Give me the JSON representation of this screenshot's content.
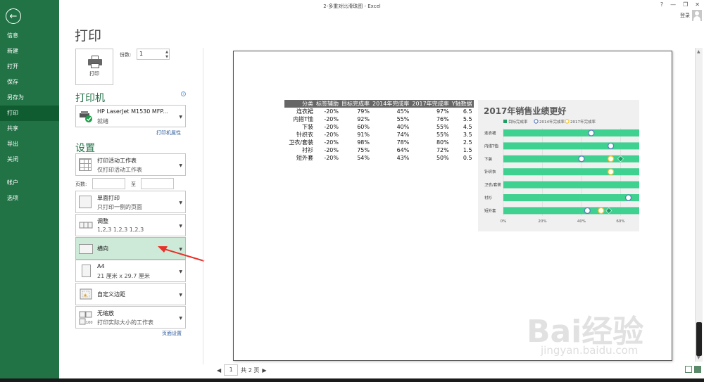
{
  "window": {
    "title": "2-多重对比滑珠图 - Excel",
    "help": "?",
    "minimize": "—",
    "restore": "❐",
    "close": "✕",
    "login": "登录"
  },
  "nav": {
    "back_icon": "←",
    "items": [
      "信息",
      "新建",
      "打开",
      "保存",
      "另存为",
      "打印",
      "共享",
      "导出",
      "关闭",
      "帐户",
      "选项"
    ],
    "active": "打印"
  },
  "print": {
    "title": "打印",
    "button_label": "打印",
    "copies_label": "份数:",
    "copies_value": "1",
    "printer_heading": "打印机",
    "printer_name": "HP LaserJet M1530 MFP...",
    "printer_status": "就绪",
    "printer_props_link": "打印机属性",
    "settings_heading": "设置",
    "scope_l1": "打印活动工作表",
    "scope_l2": "仅打印活动工作表",
    "pages_label": "页数:",
    "pages_to": "至",
    "sides_l1": "单面打印",
    "sides_l2": "只打印一侧的页面",
    "collate_l1": "调整",
    "collate_l2": "1,2,3    1,2,3    1,2,3",
    "orientation": "横向",
    "paper_l1": "A4",
    "paper_l2": "21 厘米 x 29.7 厘米",
    "margins": "自定义边距",
    "scaling_l1": "无缩放",
    "scaling_l2": "打印实际大小的工作表",
    "page_setup_link": "页面设置"
  },
  "table": {
    "headers": [
      "分类",
      "标签辅助",
      "目标完成率",
      "2014年完成率",
      "2017年完成率",
      "Y轴数据"
    ],
    "rows": [
      [
        "连衣裙",
        "-20%",
        "79%",
        "45%",
        "97%",
        "6.5"
      ],
      [
        "内搭T恤",
        "-20%",
        "92%",
        "55%",
        "76%",
        "5.5"
      ],
      [
        "下装",
        "-20%",
        "60%",
        "40%",
        "55%",
        "4.5"
      ],
      [
        "针织衣",
        "-20%",
        "91%",
        "74%",
        "55%",
        "3.5"
      ],
      [
        "卫衣/套装",
        "-20%",
        "98%",
        "78%",
        "80%",
        "2.5"
      ],
      [
        "衬衫",
        "-20%",
        "75%",
        "64%",
        "72%",
        "1.5"
      ],
      [
        "短外套",
        "-20%",
        "54%",
        "43%",
        "50%",
        "0.5"
      ]
    ]
  },
  "chart_data": {
    "type": "scatter",
    "title": "2017年销售业绩更好",
    "legend": [
      "目标完成率",
      "2014年完成率",
      "2017年完成率"
    ],
    "categories": [
      "连衣裙",
      "内搭T恤",
      "下装",
      "针织衣",
      "卫衣/套装",
      "衬衫",
      "短外套"
    ],
    "series": [
      {
        "name": "目标完成率",
        "values": [
          0.79,
          0.92,
          0.6,
          0.91,
          0.98,
          0.75,
          0.54
        ]
      },
      {
        "name": "2014年完成率",
        "values": [
          0.45,
          0.55,
          0.4,
          0.74,
          0.78,
          0.64,
          0.43
        ]
      },
      {
        "name": "2017年完成率",
        "values": [
          0.97,
          0.76,
          0.55,
          0.55,
          0.8,
          0.72,
          0.5
        ]
      }
    ],
    "x_ticks": [
      "0%",
      "20%",
      "40%",
      "60%"
    ],
    "xlim": [
      0,
      0.7
    ],
    "legend_position": "top",
    "colors": {
      "bar": "#3fd18f",
      "target": "#1f9e63",
      "y2014": "#5b7fbf",
      "y2017": "#f2c230",
      "background": "#f0f0f0",
      "title": "#595959"
    }
  },
  "preview_nav": {
    "current": "1",
    "total": "共 2 页"
  },
  "watermark": {
    "text": "Bai经验",
    "url": "jingyan.baidu.com"
  }
}
